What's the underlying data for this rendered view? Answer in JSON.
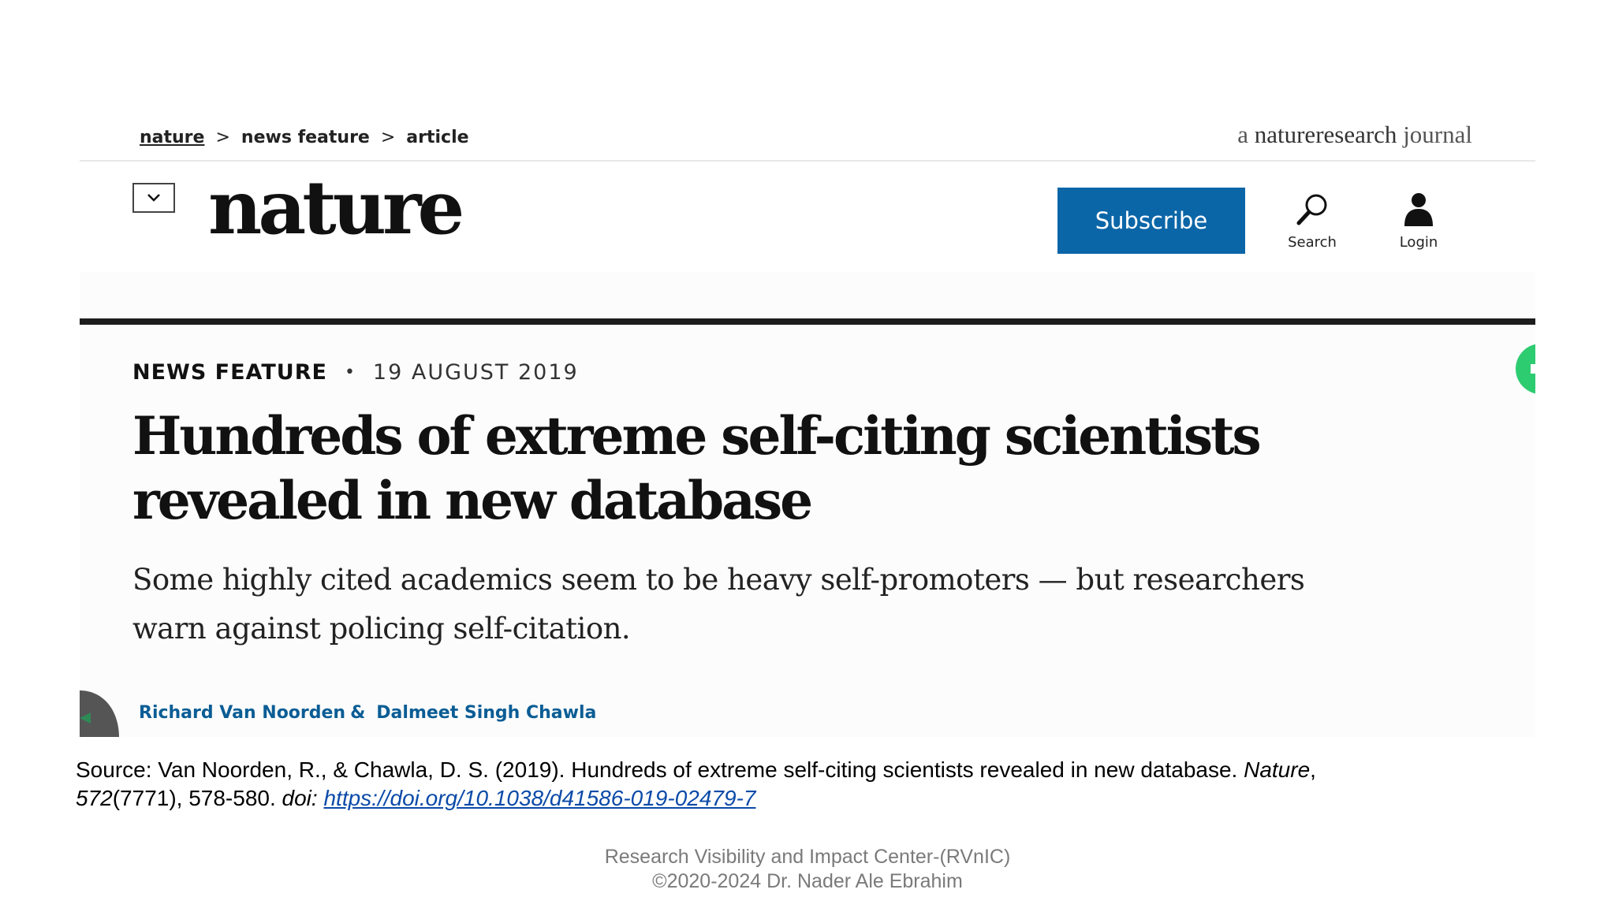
{
  "breadcrumb": {
    "items": [
      "nature",
      "news feature",
      "article"
    ],
    "separator": ">"
  },
  "journal_tag": {
    "prefix": "a",
    "brand": "natureresearch",
    "suffix": "journal"
  },
  "header": {
    "menu_icon": "chevron-down-icon",
    "logo_text": "nature",
    "subscribe_label": "Subscribe",
    "subscribe_color": "#0b66a8",
    "search_label": "Search",
    "search_icon": "search-icon",
    "login_label": "Login",
    "login_icon": "user-icon"
  },
  "article": {
    "type": "NEWS FEATURE",
    "date": "19 AUGUST 2019",
    "title_line1": "Hundreds of extreme self-citing scientists",
    "title_line2": "revealed in new database",
    "standfirst_line1": "Some highly cited academics seem to be heavy self-promoters — but researchers",
    "standfirst_line2": "warn against policing self-citation.",
    "author1": "Richard Van Noorden",
    "author_separator": "&",
    "author2": "Dalmeet Singh Chawla",
    "author_color": "#0a5d95"
  },
  "source": {
    "prefix": "Source: Van Noorden, R., & Chawla, D. S. (2019). Hundreds of extreme self-citing scientists revealed in new database. ",
    "journal": "Nature",
    "comma": ",",
    "volume": "572",
    "issue_pages": "(7771), 578-580. ",
    "doi_label": "doi: ",
    "doi_url": "https://doi.org/10.1038/d41586-019-02479-7"
  },
  "footer": {
    "line1": "Research Visibility and Impact Center-(RVnIC)",
    "line2": "©2020-2024 Dr. Nader Ale Ebrahim"
  }
}
